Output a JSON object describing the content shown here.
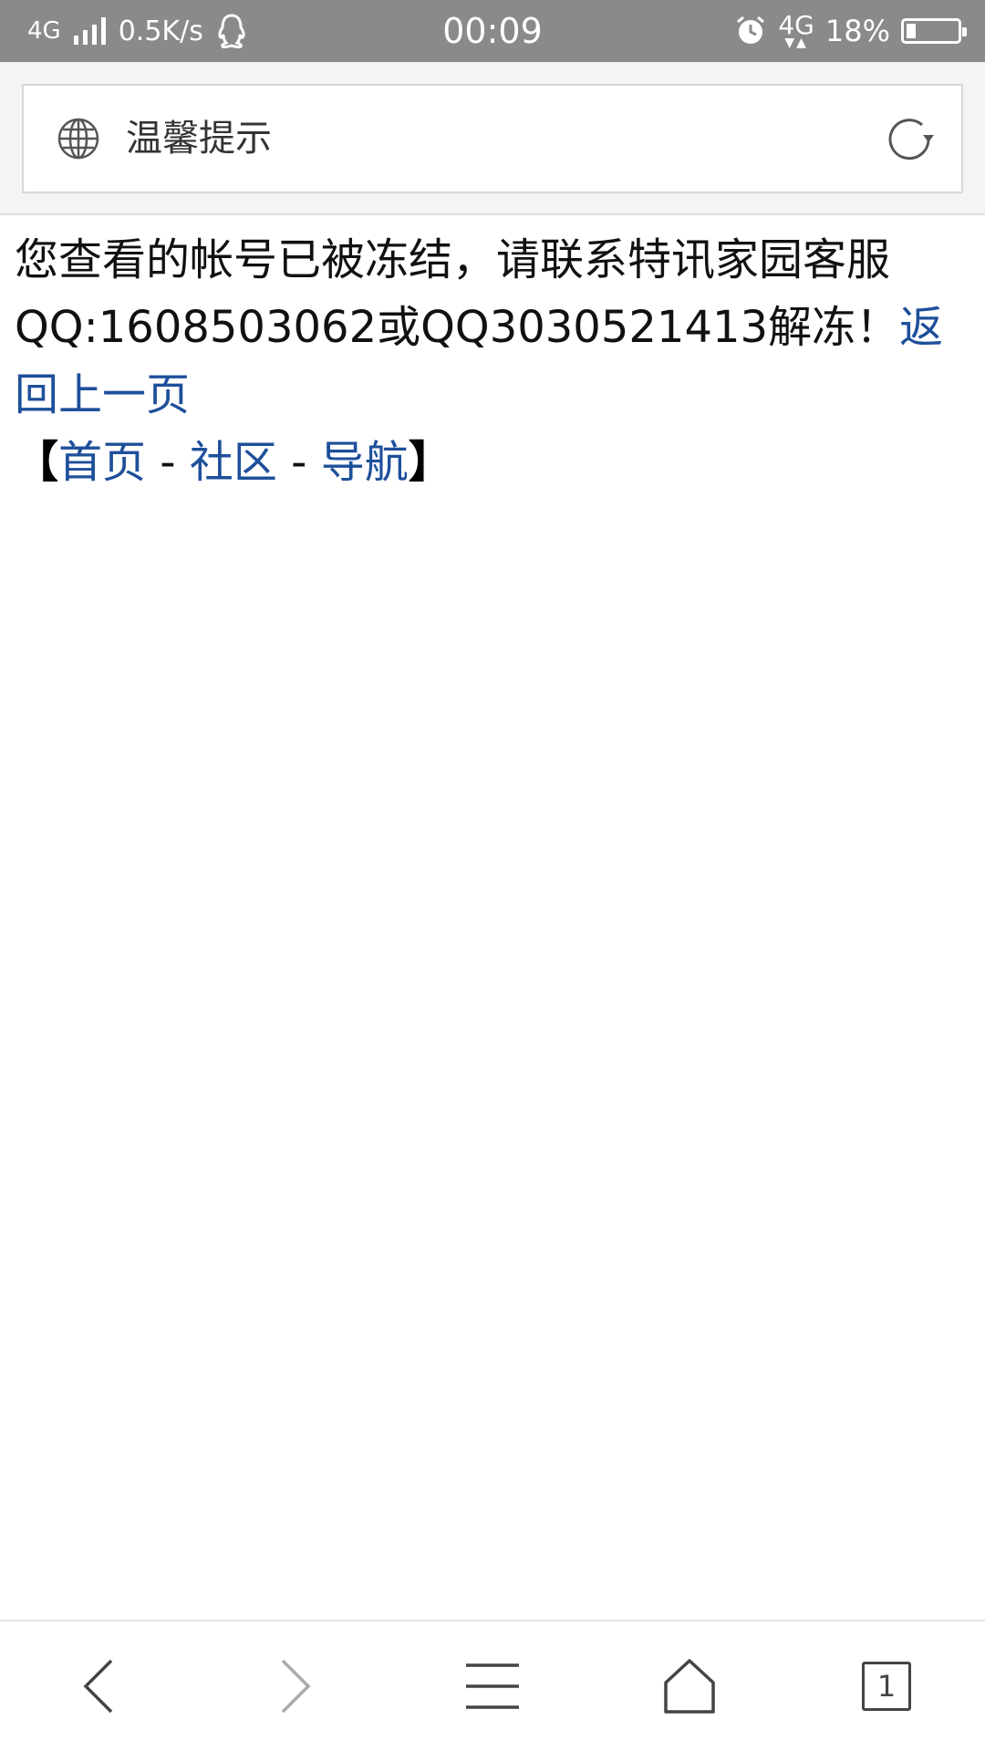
{
  "status_bar": {
    "network": "4G",
    "speed": "0.5K/s",
    "time": "00:09",
    "network2": "4G",
    "battery": "18%",
    "battery_level": 0.18,
    "icons": [
      "signal-icon",
      "qq-icon",
      "alarm-icon",
      "battery-icon"
    ]
  },
  "header": {
    "page_title": "温馨提示",
    "icons": [
      "globe-icon",
      "refresh-icon"
    ]
  },
  "content": {
    "message": "您查看的帐号已被冻结，请联系特讯家园客服QQ:1608503062或QQ3030521413解冻！",
    "back_link": "返回上一页",
    "nav": {
      "open_bracket": "【",
      "home": "首页",
      "sep1": " - ",
      "community": "社区",
      "sep2": " - ",
      "navigation": "导航",
      "close_bracket": "】"
    }
  },
  "bottom_bar": {
    "tab_count": "1",
    "icons": [
      "back-icon",
      "forward-icon",
      "menu-icon",
      "home-icon",
      "tabs-icon"
    ]
  },
  "colors": {
    "status_bar_bg": "#8a8a8a",
    "link": "#1e4f9a",
    "text": "#111111"
  }
}
